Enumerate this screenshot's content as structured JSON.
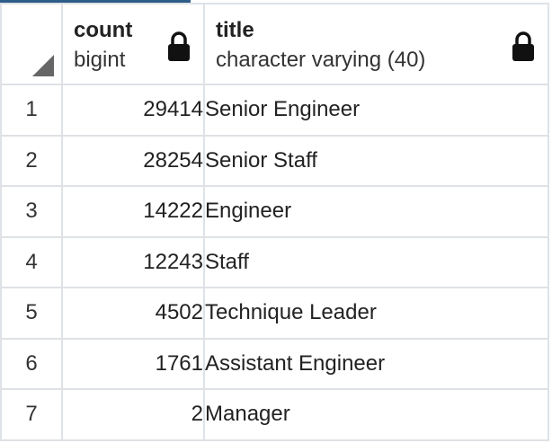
{
  "columns": [
    {
      "name": "count",
      "type": "bigint",
      "icon": "lock-icon"
    },
    {
      "name": "title",
      "type": "character varying (40)",
      "icon": "lock-icon"
    }
  ],
  "rows": [
    {
      "num": "1",
      "count": "29414",
      "title": "Senior Engineer"
    },
    {
      "num": "2",
      "count": "28254",
      "title": "Senior Staff"
    },
    {
      "num": "3",
      "count": "14222",
      "title": "Engineer"
    },
    {
      "num": "4",
      "count": "12243",
      "title": "Staff"
    },
    {
      "num": "5",
      "count": "4502",
      "title": "Technique Leader"
    },
    {
      "num": "6",
      "count": "1761",
      "title": "Assistant Engineer"
    },
    {
      "num": "7",
      "count": "2",
      "title": "Manager"
    }
  ],
  "colors": {
    "border": "#dee2e6",
    "accent_strip": "#2f5d8a",
    "text": "#222222"
  }
}
